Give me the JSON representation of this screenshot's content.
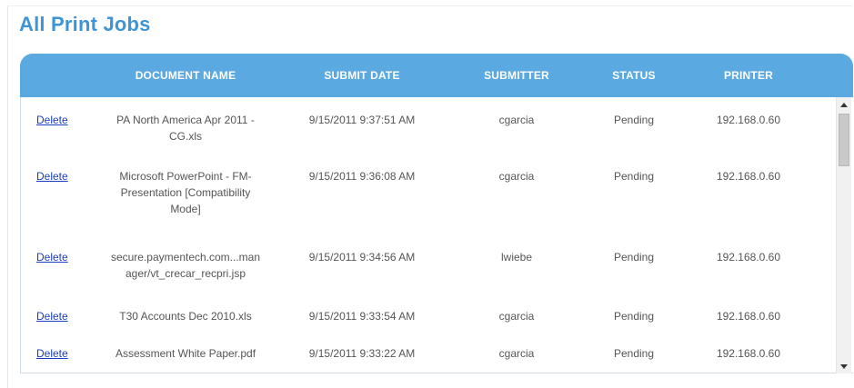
{
  "page": {
    "title": "All Print Jobs"
  },
  "colors": {
    "title": "#3d95d6",
    "header_bg": "#5aa9e0",
    "header_text": "#ffffff",
    "link": "#1a3fbf",
    "cell_text": "#555555"
  },
  "table": {
    "columns": {
      "document_name": "DOCUMENT NAME",
      "submit_date": "SUBMIT DATE",
      "submitter": "SUBMITTER",
      "status": "STATUS",
      "printer": "PRINTER"
    },
    "rows": [
      {
        "action": "Delete",
        "document_lines": [
          "PA North America Apr 2011 -",
          "CG.xls"
        ],
        "submit_date": "9/15/2011 9:37:51 AM",
        "submitter": "cgarcia",
        "status": "Pending",
        "printer": "192.168.0.60"
      },
      {
        "action": "Delete",
        "document_lines": [
          "Microsoft PowerPoint - FM-",
          "Presentation [Compatibility",
          "Mode]"
        ],
        "submit_date": "9/15/2011 9:36:08 AM",
        "submitter": "cgarcia",
        "status": "Pending",
        "printer": "192.168.0.60"
      },
      {
        "action": "Delete",
        "document_lines": [
          "secure.paymentech.com...man",
          "ager/vt_crecar_recpri.jsp"
        ],
        "submit_date": "9/15/2011 9:34:56 AM",
        "submitter": "lwiebe",
        "status": "Pending",
        "printer": "192.168.0.60"
      },
      {
        "action": "Delete",
        "document_lines": [
          "T30 Accounts Dec 2010.xls"
        ],
        "submit_date": "9/15/2011 9:33:54 AM",
        "submitter": "cgarcia",
        "status": "Pending",
        "printer": "192.168.0.60"
      },
      {
        "action": "Delete",
        "document_lines": [
          "Assessment White Paper.pdf"
        ],
        "submit_date": "9/15/2011 9:33:22 AM",
        "submitter": "cgarcia",
        "status": "Pending",
        "printer": "192.168.0.60"
      }
    ]
  },
  "scrollbar": {
    "up_icon": "arrow-up-icon",
    "down_icon": "arrow-down-icon"
  }
}
